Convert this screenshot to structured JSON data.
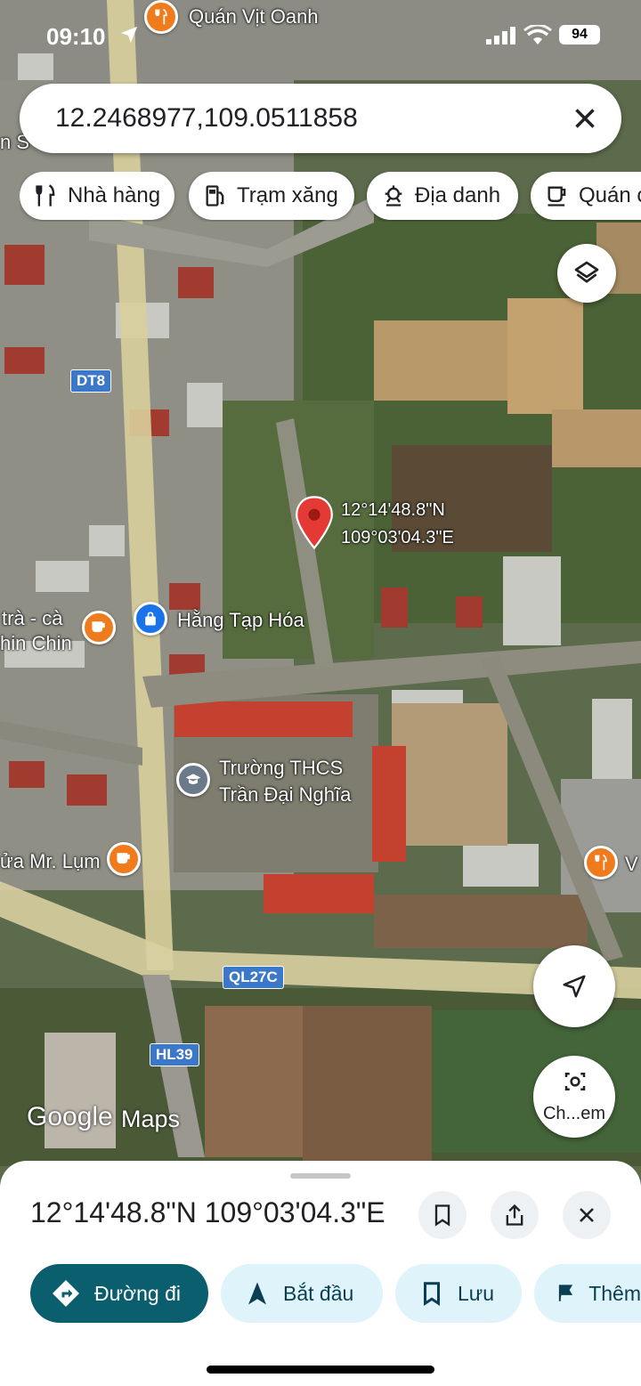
{
  "status_bar": {
    "time": "09:10",
    "battery": "94"
  },
  "search": {
    "query": "12.2468977,109.0511858"
  },
  "chips": [
    {
      "label": "Nhà hàng",
      "icon": "fork-knife-icon"
    },
    {
      "label": "Trạm xăng",
      "icon": "gas-station-icon"
    },
    {
      "label": "Địa danh",
      "icon": "landmark-icon"
    },
    {
      "label": "Quán c",
      "icon": "coffee-icon"
    }
  ],
  "map": {
    "pin_lat": "12°14'48.8\"N",
    "pin_lng": "109°03'04.3\"E",
    "places": {
      "quan_vit_oanh": "Quán Vịt Oanh",
      "hang_tap_hoa": "Hằng Tạp Hóa",
      "tra_ca_line1": "trà - cà",
      "tra_ca_line2": "hin Chin",
      "school_line1": "Trường THCS",
      "school_line2": "Trần Đại Nghĩa",
      "mr_lum": "ửa Mr. Lụm",
      "left_edge": "n S",
      "right_edge": "V"
    },
    "roads": {
      "dt8": "DT8",
      "ql27c": "QL27C",
      "hl39": "HL39"
    },
    "attribution_google": "Google",
    "attribution_maps": "Maps",
    "camera_label": "Ch...em"
  },
  "sheet": {
    "title": "12°14'48.8\"N 109°03'04.3\"E",
    "actions": [
      {
        "label": "Đường đi",
        "icon": "directions-icon"
      },
      {
        "label": "Bắt đầu",
        "icon": "navigation-arrow-icon"
      },
      {
        "label": "Lưu",
        "icon": "bookmark-icon"
      },
      {
        "label": "Thêm",
        "icon": "flag-icon"
      }
    ]
  },
  "colors": {
    "primary": "#0b5e6e",
    "chip_bg": "#dff3fb",
    "pin": "#e53935",
    "poi_orange": "#f07b1d",
    "poi_blue": "#1a73e8"
  }
}
